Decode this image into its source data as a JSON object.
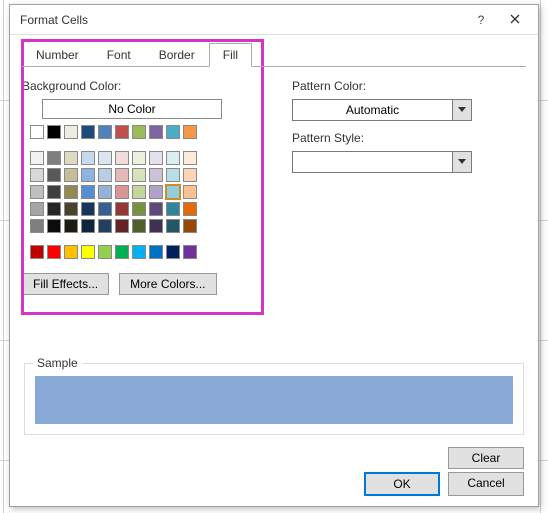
{
  "window": {
    "title": "Format Cells",
    "help_icon": "?",
    "close_icon": "✕"
  },
  "tabs": {
    "number": "Number",
    "font": "Font",
    "border": "Border",
    "fill": "Fill",
    "active": "Fill"
  },
  "labels": {
    "background_color": "Background Color:",
    "no_color": "No Color",
    "pattern_color": "Pattern Color:",
    "pattern_style": "Pattern Style:",
    "sample": "Sample"
  },
  "buttons": {
    "fill_effects": "Fill Effects...",
    "more_colors": "More Colors...",
    "clear": "Clear",
    "ok": "OK",
    "cancel": "Cancel"
  },
  "pattern_color_value": "Automatic",
  "pattern_style_value": "",
  "sample_color": "#8aa9d6",
  "standard_row1": [
    "#ffffff",
    "#000000",
    "#eeece1",
    "#1f497d",
    "#4f81bd",
    "#c0504d",
    "#9bbb59",
    "#8064a2",
    "#4bacc6",
    "#f79646"
  ],
  "theme_matrix": [
    [
      "#f2f2f2",
      "#7f7f7f",
      "#ddd9c3",
      "#c6d9f0",
      "#dbe5f1",
      "#f2dcdb",
      "#ebf1dd",
      "#e5e0ec",
      "#dbeef3",
      "#fdeada"
    ],
    [
      "#d8d8d8",
      "#595959",
      "#c4bd97",
      "#8db3e2",
      "#b8cce4",
      "#e5b9b7",
      "#d7e3bc",
      "#ccc1d9",
      "#b7dde8",
      "#fbd5b5"
    ],
    [
      "#bfbfbf",
      "#3f3f3f",
      "#938953",
      "#548dd4",
      "#95b3d7",
      "#d99694",
      "#c3d69b",
      "#b2a2c7",
      "#92cddc",
      "#fac08f"
    ],
    [
      "#a5a5a5",
      "#262626",
      "#494429",
      "#17365d",
      "#366092",
      "#953734",
      "#76923c",
      "#5f497a",
      "#31859b",
      "#e36c09"
    ],
    [
      "#7f7f7f",
      "#0c0c0c",
      "#1d1b10",
      "#0f243e",
      "#244061",
      "#632423",
      "#4f6128",
      "#3f3151",
      "#205867",
      "#974806"
    ]
  ],
  "standard_colors": [
    "#c00000",
    "#ff0000",
    "#ffc000",
    "#ffff00",
    "#92d050",
    "#00b050",
    "#00b0f0",
    "#0070c0",
    "#002060",
    "#7030a0"
  ],
  "selected_swatch": {
    "row": 2,
    "col": 8
  }
}
